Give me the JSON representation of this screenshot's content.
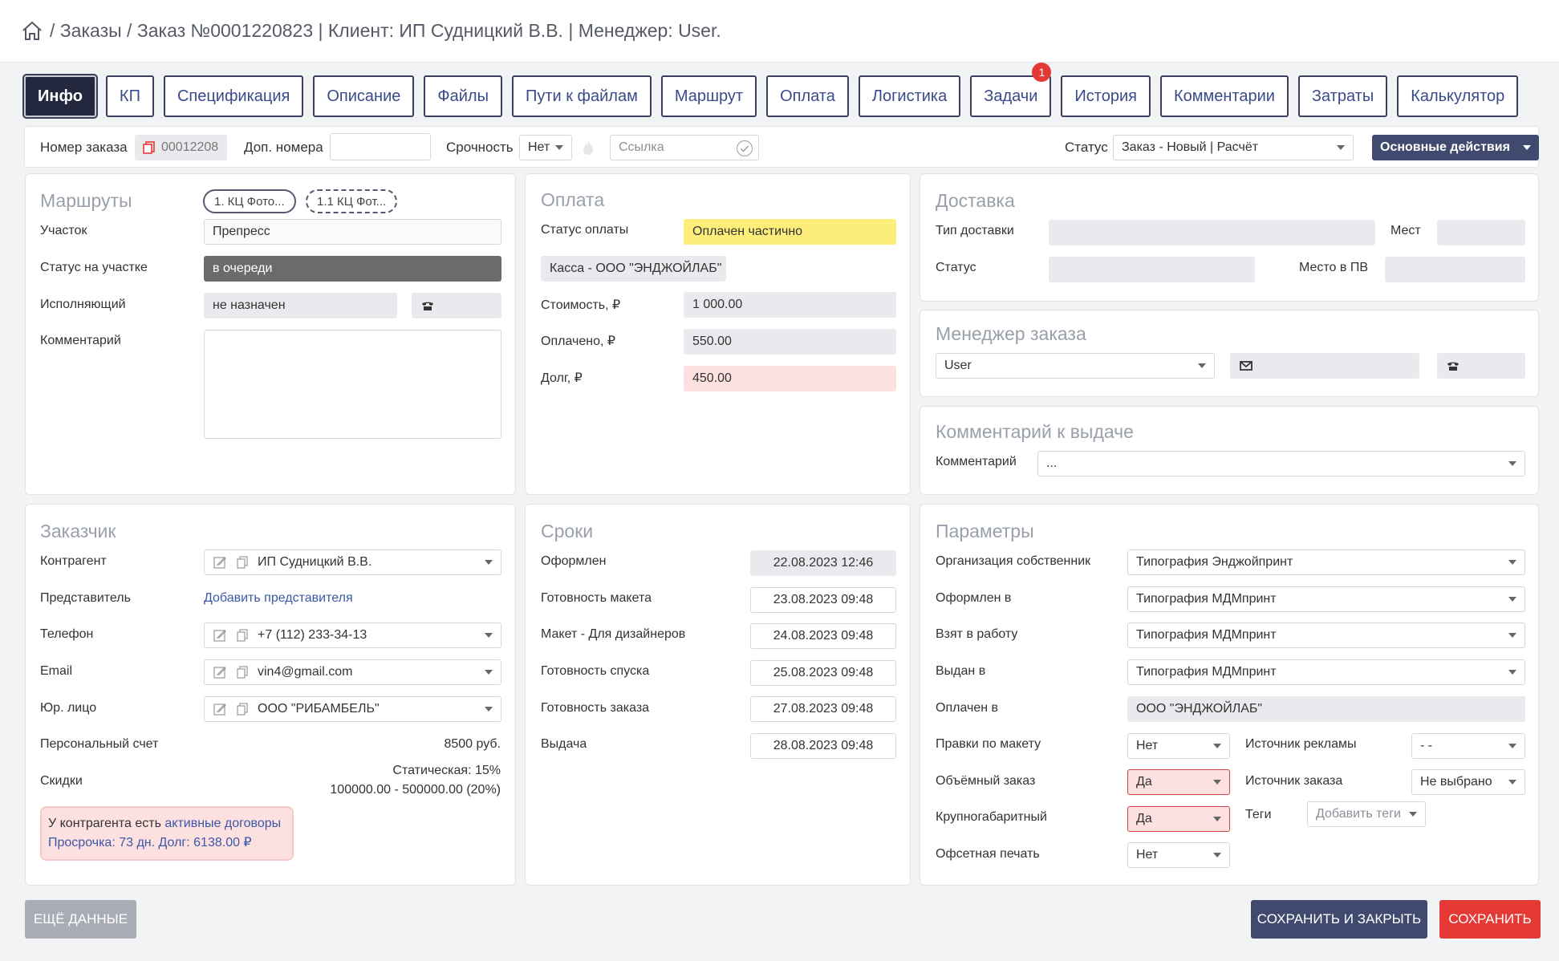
{
  "breadcrumb": {
    "sep": "/",
    "orders": "Заказы",
    "order": "Заказ №0001220823",
    "pipe1": "|",
    "client": "Клиент: ИП Судницкий В.В.",
    "pipe2": "|",
    "manager": "Менеджер: User."
  },
  "tabs": [
    {
      "label": "Инфо",
      "active": true
    },
    {
      "label": "КП"
    },
    {
      "label": "Спецификация"
    },
    {
      "label": "Описание"
    },
    {
      "label": "Файлы"
    },
    {
      "label": "Пути к файлам"
    },
    {
      "label": "Маршрут"
    },
    {
      "label": "Оплата"
    },
    {
      "label": "Логистика"
    },
    {
      "label": "Задачи",
      "badge": "1"
    },
    {
      "label": "История"
    },
    {
      "label": "Комментарии"
    },
    {
      "label": "Затраты"
    },
    {
      "label": "Калькулятор"
    }
  ],
  "toolbar": {
    "order_number_label": "Номер заказа",
    "order_number_value": "00012208",
    "extra_numbers_label": "Доп. номера",
    "extra_numbers_value": "",
    "urgency_label": "Срочность",
    "urgency_value": "Нет",
    "link_placeholder": "Ссылка",
    "status_label": "Статус",
    "status_value": "Заказ - Новый | Расчёт",
    "actions_button": "Основные действия"
  },
  "routes": {
    "title": "Маршруты",
    "chips": [
      "1. КЦ Фото...",
      "1.1 КЦ Фот..."
    ],
    "section_label": "Участок",
    "section_value": "Препресс",
    "section_status_label": "Статус на участке",
    "section_status_value": "в очереди",
    "executor_label": "Исполняющий",
    "executor_value": "не назначен",
    "comment_label": "Комментарий",
    "comment_value": ""
  },
  "payment": {
    "title": "Оплата",
    "status_label": "Статус оплаты",
    "status_value": "Оплачен частично",
    "cashbox": "Касса - ООО \"ЭНДЖОЙЛАБ\"",
    "cost_label": "Стоимость, ₽",
    "cost_value": "1 000.00",
    "paid_label": "Оплачено, ₽",
    "paid_value": "550.00",
    "debt_label": "Долг, ₽",
    "debt_value": "450.00"
  },
  "delivery": {
    "title": "Доставка",
    "type_label": "Тип доставки",
    "type_value": "",
    "places_label": "Мест",
    "places_value": "",
    "status_label": "Статус",
    "status_value": "",
    "pv_label": "Место в ПВ",
    "pv_value": ""
  },
  "manager": {
    "title": "Менеджер заказа",
    "name": "User",
    "email": "",
    "phone": ""
  },
  "issue_comment": {
    "title": "Комментарий к выдаче",
    "label": "Комментарий",
    "value": "..."
  },
  "customer": {
    "title": "Заказчик",
    "counterparty_label": "Контрагент",
    "counterparty_value": "ИП Судницкий В.В.",
    "rep_label": "Представитель",
    "rep_link": "Добавить представителя",
    "phone_label": "Телефон",
    "phone_value": "+7 (112) 233-34-13",
    "email_label": "Email",
    "email_value": "vin4@gmail.com",
    "legal_label": "Юр. лицо",
    "legal_value": "ООО \"РИБАМБЕЛЬ\"",
    "account_label": "Персональный счет",
    "account_value": "8500 руб.",
    "discounts_label": "Скидки",
    "discount_static": "Статическая: 15%",
    "discount_range": "100000.00 - 500000.00 (20%)",
    "warn_prefix": "У контрагента есть",
    "warn_link": "активные договоры",
    "warn_overdue": "Просрочка: 73 дн. Долг: 6138.00 ₽"
  },
  "deadlines": {
    "title": "Сроки",
    "rows": [
      {
        "label": "Оформлен",
        "value": "22.08.2023 12:46",
        "readonly": true
      },
      {
        "label": "Готовность макета",
        "value": "23.08.2023 09:48"
      },
      {
        "label": "Макет - Для дизайнеров",
        "value": "24.08.2023 09:48"
      },
      {
        "label": "Готовность спуска",
        "value": "25.08.2023 09:48"
      },
      {
        "label": "Готовность заказа",
        "value": "27.08.2023 09:48"
      },
      {
        "label": "Выдача",
        "value": "28.08.2023 09:48"
      }
    ]
  },
  "params": {
    "title": "Параметры",
    "owner_org_label": "Организация собственник",
    "owner_org_value": "Типография Энджойпринт",
    "issued_in_label": "Оформлен в",
    "issued_in_value": "Типография МДМпринт",
    "taken_label": "Взят в работу",
    "taken_value": "Типография МДМпринт",
    "given_label": "Выдан в",
    "given_value": "Типография МДМпринт",
    "paid_in_label": "Оплачен в",
    "paid_in_value": "ООО \"ЭНДЖОЙЛАБ\"",
    "edits_label": "Правки по макету",
    "edits_value": "Нет",
    "ad_source_label": "Источник рекламы",
    "ad_source_value": "- -",
    "bulk_label": "Объёмный заказ",
    "bulk_value": "Да",
    "order_source_label": "Источник заказа",
    "order_source_value": "Не выбрано",
    "large_label": "Крупногабаритный",
    "large_value": "Да",
    "tags_label": "Теги",
    "tags_placeholder": "Добавить теги",
    "offset_label": "Офсетная печать",
    "offset_value": "Нет"
  },
  "footer": {
    "more_data": "ЕЩЁ ДАННЫЕ",
    "save_close": "СОХРАНИТЬ И ЗАКРЫТЬ",
    "save": "СОХРАНИТЬ"
  },
  "colors": {
    "accent": "#404a6e",
    "danger": "#e53935",
    "paid_partial": "#fdee7a",
    "debt": "#fde0e0"
  }
}
